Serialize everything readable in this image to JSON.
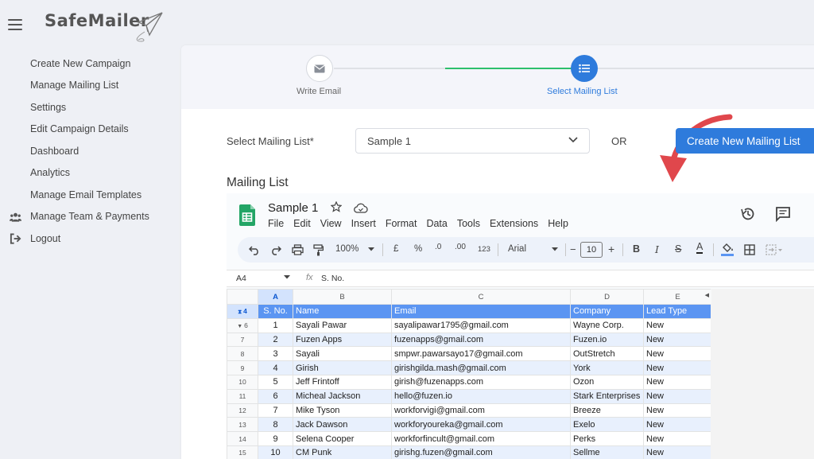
{
  "brand": {
    "name": "SafeMailer",
    "logo_icon": "paper-plane-icon"
  },
  "sidebar": {
    "items": [
      {
        "label": "Create New Campaign",
        "icon": ""
      },
      {
        "label": "Manage Mailing List",
        "icon": ""
      },
      {
        "label": "Settings",
        "icon": ""
      },
      {
        "label": "Edit Campaign Details",
        "icon": ""
      },
      {
        "label": "Dashboard",
        "icon": ""
      },
      {
        "label": "Analytics",
        "icon": ""
      },
      {
        "label": "Manage Email Templates",
        "icon": ""
      },
      {
        "label": "Manage Team & Payments",
        "icon": "users-icon"
      },
      {
        "label": "Logout",
        "icon": "logout-icon"
      }
    ]
  },
  "stepper": {
    "steps": [
      {
        "label": "Write Email",
        "icon": "envelope-icon",
        "state": "done"
      },
      {
        "label": "Select Mailing List",
        "icon": "list-icon",
        "state": "active"
      }
    ],
    "colors": {
      "active": "#2e7bdc",
      "progress": "#2dbf6c"
    }
  },
  "select_row": {
    "label": "Select Mailing List*",
    "value": "Sample 1",
    "or_text": "OR",
    "create_button": "Create New Mailing List"
  },
  "mailing_list": {
    "title": "Mailing List",
    "sheet": {
      "name": "Sample 1",
      "menu": [
        "File",
        "Edit",
        "View",
        "Insert",
        "Format",
        "Data",
        "Tools",
        "Extensions",
        "Help"
      ],
      "toolbar": {
        "zoom": "100%",
        "currency": "£",
        "percent": "%",
        "dec_decrease": ".0",
        "dec_increase": ".00",
        "number_format": "123",
        "font": "Arial",
        "font_size": "10",
        "minus": "−",
        "plus": "+",
        "bold": "B",
        "italic": "I",
        "strike": "S",
        "text_color": "A"
      },
      "formula_bar": {
        "cell": "A4",
        "fx": "fx",
        "value": "S. No."
      },
      "columns": [
        "A",
        "B",
        "C",
        "D",
        "E"
      ],
      "header_row_number": "4",
      "header": [
        "S. No.",
        "Name",
        "Email",
        "Company",
        "Lead Type"
      ],
      "rows": [
        {
          "rownum": "6",
          "cells": [
            "1",
            "Sayali Pawar",
            "sayalipawar1795@gmail.com",
            "Wayne Corp.",
            "New"
          ]
        },
        {
          "rownum": "7",
          "cells": [
            "2",
            "Fuzen Apps",
            "fuzenapps@gmail.com",
            "Fuzen.io",
            "New"
          ]
        },
        {
          "rownum": "8",
          "cells": [
            "3",
            "Sayali",
            "smpwr.pawarsayo17@gmail.com",
            "OutStretch",
            "New"
          ]
        },
        {
          "rownum": "9",
          "cells": [
            "4",
            "Girish",
            "girishgilda.mash@gmail.com",
            "York",
            "New"
          ]
        },
        {
          "rownum": "10",
          "cells": [
            "5",
            "Jeff Frintoff",
            "girish@fuzenapps.com",
            "Ozon",
            "New"
          ]
        },
        {
          "rownum": "11",
          "cells": [
            "6",
            "Micheal Jackson",
            "hello@fuzen.io",
            "Stark Enterprises",
            "New"
          ]
        },
        {
          "rownum": "12",
          "cells": [
            "7",
            "Mike Tyson",
            "workforvigi@gmail.com",
            "Breeze",
            "New"
          ]
        },
        {
          "rownum": "13",
          "cells": [
            "8",
            "Jack Dawson",
            "workforyoureka@gmail.com",
            "Exelo",
            "New"
          ]
        },
        {
          "rownum": "14",
          "cells": [
            "9",
            "Selena Cooper",
            "workforfincult@gmail.com",
            "Perks",
            "New"
          ]
        },
        {
          "rownum": "15",
          "cells": [
            "10",
            "CM Punk",
            "girishg.fuzen@gmail.com",
            "Sellme",
            "New"
          ]
        }
      ],
      "colors": {
        "header_fill": "#5b95f2",
        "band_fill": "#e8f0fd",
        "sheets_green": "#23a566"
      }
    }
  },
  "annotation": {
    "icon": "curved-arrow-icon",
    "color": "#e0474c"
  }
}
